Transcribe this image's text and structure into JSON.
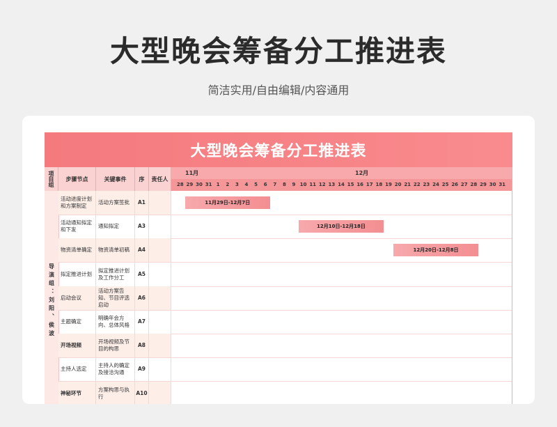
{
  "header": {
    "title": "大型晚会筹备分工推进表",
    "subtitle": "简洁实用/自由编辑/内容通用"
  },
  "sheet": {
    "banner_title": "大型晚会筹备分工推进表",
    "columns": {
      "group": "项目组",
      "step": "步骤节点",
      "event": "关键事件",
      "seq": "序",
      "owner": "责任人"
    },
    "months": [
      "11月",
      "12月"
    ],
    "days": [
      "28",
      "29",
      "30",
      "31",
      "1",
      "2",
      "3",
      "4",
      "5",
      "6",
      "7",
      "8",
      "9",
      "10",
      "11",
      "12",
      "13",
      "14",
      "15",
      "16",
      "17",
      "18",
      "19",
      "20",
      "21",
      "22",
      "23",
      "24",
      "25",
      "26",
      "27",
      "28",
      "29",
      "30",
      "31"
    ],
    "group_name": "导演组：刘阳、侯波",
    "rows": [
      {
        "step": "活动进度计划和方案制定",
        "event": "活动方案签批",
        "seq": "A1",
        "owner": "",
        "step_bold": false
      },
      {
        "step": "活动通知拟定和下发",
        "event": "通知拟定",
        "seq": "A3",
        "owner": "",
        "step_bold": false
      },
      {
        "step": "物资清单确定",
        "event": "物资清单初稿",
        "seq": "A4",
        "owner": "",
        "step_bold": false
      },
      {
        "step": "拟定推进计划",
        "event": "拟定推进计划及工作分工",
        "seq": "A5",
        "owner": "",
        "step_bold": false
      },
      {
        "step": "启动会议",
        "event": "活动方案告知、节目评选启动",
        "seq": "A6",
        "owner": "",
        "step_bold": false
      },
      {
        "step": "主题确定",
        "event": "明确年会方向、总体风格",
        "seq": "A7",
        "owner": "",
        "step_bold": false
      },
      {
        "step": "开场视频",
        "event": "开场视频及节目的构思",
        "seq": "A8",
        "owner": "",
        "step_bold": true
      },
      {
        "step": "主持人选定",
        "event": "主持人的确定及接洽沟通",
        "seq": "A9",
        "owner": "",
        "step_bold": false
      },
      {
        "step": "神秘环节",
        "event": "方案构思与执行",
        "seq": "A10",
        "owner": "",
        "step_bold": true
      }
    ],
    "gantt": [
      {
        "row": 0,
        "label": "11月29日-12月7日",
        "start_day_index": 1,
        "end_day_index": 10
      },
      {
        "row": 1,
        "label": "12月10日-12月18日",
        "start_day_index": 13,
        "end_day_index": 22
      },
      {
        "row": 2,
        "label": "12月20日-12月8日",
        "start_day_index": 23,
        "end_day_index": 32
      }
    ]
  }
}
